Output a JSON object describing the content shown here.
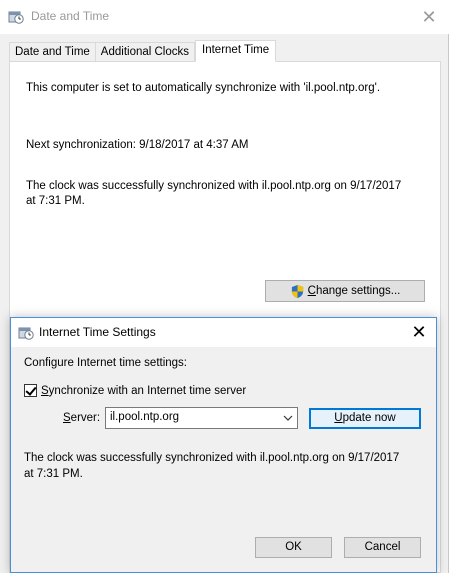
{
  "window": {
    "title": "Date and Time",
    "close_glyph": "✕"
  },
  "tabs": [
    {
      "label": "Date and Time"
    },
    {
      "label": "Additional Clocks"
    },
    {
      "label": "Internet Time",
      "active": true
    }
  ],
  "internet_time_panel": {
    "auto_sync_text": "This computer is set to automatically synchronize with 'il.pool.ntp.org'.",
    "next_sync_text": "Next synchronization: 9/18/2017 at 4:37 AM",
    "last_sync_line1": "The clock was successfully synchronized with il.pool.ntp.org on 9/17/2017",
    "last_sync_line2": "at 7:31 PM.",
    "change_settings_label_first": "C",
    "change_settings_label_rest": "hange settings..."
  },
  "dialog": {
    "title": "Internet Time Settings",
    "close_glyph": "✕",
    "configure_label": "Configure Internet time settings:",
    "sync_checkbox_first": "S",
    "sync_checkbox_rest": "ynchronize with an Internet time server",
    "sync_checked": true,
    "server_label_first": "S",
    "server_label_rest": "erver:",
    "server_value": "il.pool.ntp.org",
    "update_now_first": "U",
    "update_now_rest": "pdate now",
    "status_line1": "The clock was successfully synchronized with il.pool.ntp.org on 9/17/2017",
    "status_line2": "at 7:31 PM.",
    "ok_label": "OK",
    "cancel_label": "Cancel"
  },
  "icons": {
    "app": "date-time-icon",
    "shield": "uac-shield-icon",
    "dropdown": "chevron-down-icon"
  },
  "colors": {
    "focus_border": "#0078d7",
    "button_face": "#e1e1e1",
    "window_bg": "#f0f0f0"
  }
}
